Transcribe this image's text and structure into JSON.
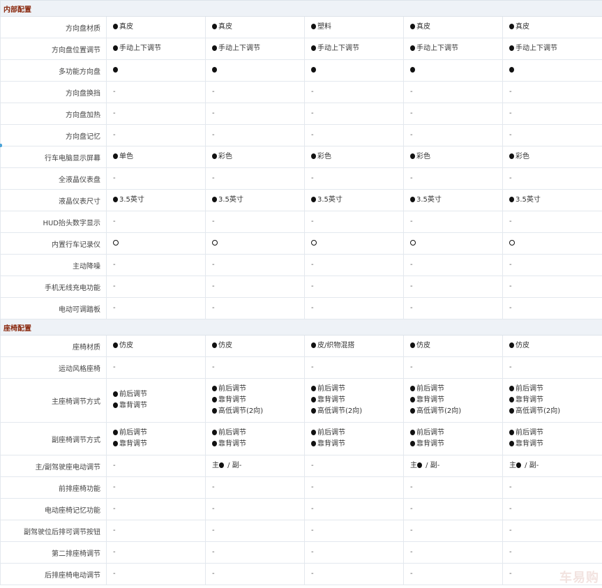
{
  "watermark": "车易购",
  "sections": [
    {
      "title": "内部配置",
      "rows": [
        {
          "label": "方向盘材质",
          "cells": [
            [
              {
                "icon": "dot",
                "text": "真皮"
              }
            ],
            [
              {
                "icon": "dot",
                "text": "真皮"
              }
            ],
            [
              {
                "icon": "dot",
                "text": "塑料"
              }
            ],
            [
              {
                "icon": "dot",
                "text": "真皮"
              }
            ],
            [
              {
                "icon": "dot",
                "text": "真皮"
              }
            ]
          ]
        },
        {
          "label": "方向盘位置调节",
          "cells": [
            [
              {
                "icon": "dot",
                "text": "手动上下调节"
              }
            ],
            [
              {
                "icon": "dot",
                "text": "手动上下调节"
              }
            ],
            [
              {
                "icon": "dot",
                "text": "手动上下调节"
              }
            ],
            [
              {
                "icon": "dot",
                "text": "手动上下调节"
              }
            ],
            [
              {
                "icon": "dot",
                "text": "手动上下调节"
              }
            ]
          ]
        },
        {
          "label": "多功能方向盘",
          "cells": [
            [
              {
                "icon": "dot",
                "text": ""
              }
            ],
            [
              {
                "icon": "dot",
                "text": ""
              }
            ],
            [
              {
                "icon": "dot",
                "text": ""
              }
            ],
            [
              {
                "icon": "dot",
                "text": ""
              }
            ],
            [
              {
                "icon": "dot",
                "text": ""
              }
            ]
          ]
        },
        {
          "label": "方向盘换挡",
          "cells": [
            [
              {
                "text": "-"
              }
            ],
            [
              {
                "text": "-"
              }
            ],
            [
              {
                "text": "-"
              }
            ],
            [
              {
                "text": "-"
              }
            ],
            [
              {
                "text": "-"
              }
            ]
          ]
        },
        {
          "label": "方向盘加热",
          "cells": [
            [
              {
                "text": "-"
              }
            ],
            [
              {
                "text": "-"
              }
            ],
            [
              {
                "text": "-"
              }
            ],
            [
              {
                "text": "-"
              }
            ],
            [
              {
                "text": "-"
              }
            ]
          ]
        },
        {
          "label": "方向盘记忆",
          "cells": [
            [
              {
                "text": "-"
              }
            ],
            [
              {
                "text": "-"
              }
            ],
            [
              {
                "text": "-"
              }
            ],
            [
              {
                "text": "-"
              }
            ],
            [
              {
                "text": "-"
              }
            ]
          ]
        },
        {
          "label": "行车电脑显示屏幕",
          "cells": [
            [
              {
                "icon": "dot",
                "text": "单色"
              }
            ],
            [
              {
                "icon": "dot",
                "text": "彩色"
              }
            ],
            [
              {
                "icon": "dot",
                "text": "彩色"
              }
            ],
            [
              {
                "icon": "dot",
                "text": "彩色"
              }
            ],
            [
              {
                "icon": "dot",
                "text": "彩色"
              }
            ]
          ]
        },
        {
          "label": "全液晶仪表盘",
          "cells": [
            [
              {
                "text": "-"
              }
            ],
            [
              {
                "text": "-"
              }
            ],
            [
              {
                "text": "-"
              }
            ],
            [
              {
                "text": "-"
              }
            ],
            [
              {
                "text": "-"
              }
            ]
          ]
        },
        {
          "label": "液晶仪表尺寸",
          "cells": [
            [
              {
                "icon": "dot",
                "text": "3.5英寸"
              }
            ],
            [
              {
                "icon": "dot",
                "text": "3.5英寸"
              }
            ],
            [
              {
                "icon": "dot",
                "text": "3.5英寸"
              }
            ],
            [
              {
                "icon": "dot",
                "text": "3.5英寸"
              }
            ],
            [
              {
                "icon": "dot",
                "text": "3.5英寸"
              }
            ]
          ]
        },
        {
          "label": "HUD抬头数字显示",
          "cells": [
            [
              {
                "text": "-"
              }
            ],
            [
              {
                "text": "-"
              }
            ],
            [
              {
                "text": "-"
              }
            ],
            [
              {
                "text": "-"
              }
            ],
            [
              {
                "text": "-"
              }
            ]
          ]
        },
        {
          "label": "内置行车记录仪",
          "cells": [
            [
              {
                "icon": "ring",
                "text": ""
              }
            ],
            [
              {
                "icon": "ring",
                "text": ""
              }
            ],
            [
              {
                "icon": "ring",
                "text": ""
              }
            ],
            [
              {
                "icon": "ring",
                "text": ""
              }
            ],
            [
              {
                "icon": "ring",
                "text": ""
              }
            ]
          ]
        },
        {
          "label": "主动降噪",
          "cells": [
            [
              {
                "text": "-"
              }
            ],
            [
              {
                "text": "-"
              }
            ],
            [
              {
                "text": "-"
              }
            ],
            [
              {
                "text": "-"
              }
            ],
            [
              {
                "text": "-"
              }
            ]
          ]
        },
        {
          "label": "手机无线充电功能",
          "cells": [
            [
              {
                "text": "-"
              }
            ],
            [
              {
                "text": "-"
              }
            ],
            [
              {
                "text": "-"
              }
            ],
            [
              {
                "text": "-"
              }
            ],
            [
              {
                "text": "-"
              }
            ]
          ]
        },
        {
          "label": "电动可调踏板",
          "cells": [
            [
              {
                "text": "-"
              }
            ],
            [
              {
                "text": "-"
              }
            ],
            [
              {
                "text": "-"
              }
            ],
            [
              {
                "text": "-"
              }
            ],
            [
              {
                "text": "-"
              }
            ]
          ]
        }
      ]
    },
    {
      "title": "座椅配置",
      "rows": [
        {
          "label": "座椅材质",
          "cells": [
            [
              {
                "icon": "dot",
                "text": "仿皮"
              }
            ],
            [
              {
                "icon": "dot",
                "text": "仿皮"
              }
            ],
            [
              {
                "icon": "dot",
                "text": "皮/织物混搭"
              }
            ],
            [
              {
                "icon": "dot",
                "text": "仿皮"
              }
            ],
            [
              {
                "icon": "dot",
                "text": "仿皮"
              }
            ]
          ]
        },
        {
          "label": "运动风格座椅",
          "cells": [
            [
              {
                "text": "-"
              }
            ],
            [
              {
                "text": "-"
              }
            ],
            [
              {
                "text": "-"
              }
            ],
            [
              {
                "text": "-"
              }
            ],
            [
              {
                "text": "-"
              }
            ]
          ]
        },
        {
          "label": "主座椅调节方式",
          "height": "r63",
          "cells": [
            [
              {
                "icon": "dot",
                "text": "前后调节"
              },
              {
                "icon": "dot",
                "text": "靠背调节"
              }
            ],
            [
              {
                "icon": "dot",
                "text": "前后调节"
              },
              {
                "icon": "dot",
                "text": "靠背调节"
              },
              {
                "icon": "dot",
                "text": "高低调节(2向)"
              }
            ],
            [
              {
                "icon": "dot",
                "text": "前后调节"
              },
              {
                "icon": "dot",
                "text": "靠背调节"
              },
              {
                "icon": "dot",
                "text": "高低调节(2向)"
              }
            ],
            [
              {
                "icon": "dot",
                "text": "前后调节"
              },
              {
                "icon": "dot",
                "text": "靠背调节"
              },
              {
                "icon": "dot",
                "text": "高低调节(2向)"
              }
            ],
            [
              {
                "icon": "dot",
                "text": "前后调节"
              },
              {
                "icon": "dot",
                "text": "靠背调节"
              },
              {
                "icon": "dot",
                "text": "高低调节(2向)"
              }
            ]
          ]
        },
        {
          "label": "副座椅调节方式",
          "height": "r47",
          "cells": [
            [
              {
                "icon": "dot",
                "text": "前后调节"
              },
              {
                "icon": "dot",
                "text": "靠背调节"
              }
            ],
            [
              {
                "icon": "dot",
                "text": "前后调节"
              },
              {
                "icon": "dot",
                "text": "靠背调节"
              }
            ],
            [
              {
                "icon": "dot",
                "text": "前后调节"
              },
              {
                "icon": "dot",
                "text": "靠背调节"
              }
            ],
            [
              {
                "icon": "dot",
                "text": "前后调节"
              },
              {
                "icon": "dot",
                "text": "靠背调节"
              }
            ],
            [
              {
                "icon": "dot",
                "text": "前后调节"
              },
              {
                "icon": "dot",
                "text": "靠背调节"
              }
            ]
          ]
        },
        {
          "label": "主/副驾驶座电动调节",
          "cells": [
            [
              {
                "text": "-"
              }
            ],
            [
              {
                "prefix": "主",
                "icon": "dot",
                "text": " / 副-"
              }
            ],
            [
              {
                "text": "-"
              }
            ],
            [
              {
                "prefix": "主",
                "icon": "dot",
                "text": " / 副-"
              }
            ],
            [
              {
                "prefix": "主",
                "icon": "dot",
                "text": " / 副-"
              }
            ]
          ]
        },
        {
          "label": "前排座椅功能",
          "cells": [
            [
              {
                "text": "-"
              }
            ],
            [
              {
                "text": "-"
              }
            ],
            [
              {
                "text": "-"
              }
            ],
            [
              {
                "text": "-"
              }
            ],
            [
              {
                "text": "-"
              }
            ]
          ]
        },
        {
          "label": "电动座椅记忆功能",
          "cells": [
            [
              {
                "text": "-"
              }
            ],
            [
              {
                "text": "-"
              }
            ],
            [
              {
                "text": "-"
              }
            ],
            [
              {
                "text": "-"
              }
            ],
            [
              {
                "text": "-"
              }
            ]
          ]
        },
        {
          "label": "副驾驶位后排可调节按钮",
          "cells": [
            [
              {
                "text": "-"
              }
            ],
            [
              {
                "text": "-"
              }
            ],
            [
              {
                "text": "-"
              }
            ],
            [
              {
                "text": "-"
              }
            ],
            [
              {
                "text": "-"
              }
            ]
          ]
        },
        {
          "label": "第二排座椅调节",
          "cells": [
            [
              {
                "text": "-"
              }
            ],
            [
              {
                "text": "-"
              }
            ],
            [
              {
                "text": "-"
              }
            ],
            [
              {
                "text": "-"
              }
            ],
            [
              {
                "text": "-"
              }
            ]
          ]
        },
        {
          "label": "后排座椅电动调节",
          "cells": [
            [
              {
                "text": "-"
              }
            ],
            [
              {
                "text": "-"
              }
            ],
            [
              {
                "text": "-"
              }
            ],
            [
              {
                "text": "-"
              }
            ],
            [
              {
                "text": "-"
              }
            ]
          ]
        }
      ]
    }
  ]
}
